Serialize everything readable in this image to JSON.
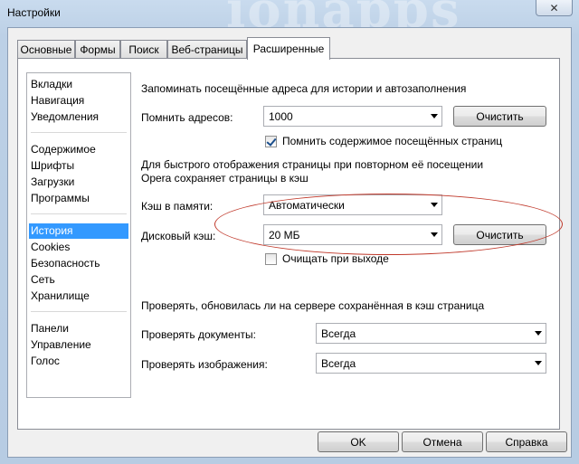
{
  "window": {
    "title": "Настройки",
    "close_glyph": "✕",
    "watermark": "ionapps"
  },
  "tabs": [
    "Основные",
    "Формы",
    "Поиск",
    "Веб-страницы",
    "Расширенные"
  ],
  "sidebar": {
    "items": [
      "Вкладки",
      "Навигация",
      "Уведомления",
      "Содержимое",
      "Шрифты",
      "Загрузки",
      "Программы",
      "История",
      "Cookies",
      "Безопасность",
      "Сеть",
      "Хранилище",
      "Панели",
      "Управление",
      "Голос"
    ],
    "selected": "История"
  },
  "history": {
    "remember_heading": "Запоминать посещённые адреса для истории и автозаполнения",
    "remember_label": "Помнить адресов:",
    "remember_value": "1000",
    "clear_label": "Очистить",
    "remember_content_label": "Помнить содержимое посещённых страниц",
    "remember_content_checked": true,
    "cache_heading_1": "Для быстрого отображения страницы при повторном её посещении",
    "cache_heading_2": "Opera сохраняет страницы в кэш",
    "memory_cache_label": "Кэш в памяти:",
    "memory_cache_value": "Автоматически",
    "disk_cache_label": "Дисковый кэш:",
    "disk_cache_value": "20 МБ",
    "disk_clear_label": "Очистить",
    "clear_on_exit_label": "Очищать при выходе",
    "clear_on_exit_checked": false,
    "check_heading": "Проверять, обновилась ли на сервере сохранённая в кэш страница",
    "check_docs_label": "Проверять документы:",
    "check_docs_value": "Всегда",
    "check_images_label": "Проверять изображения:",
    "check_images_value": "Всегда"
  },
  "footer": {
    "ok": "OK",
    "cancel": "Отмена",
    "help": "Справка"
  },
  "colors": {
    "highlight_oval": "#c0392b",
    "selection": "#3399ff"
  }
}
